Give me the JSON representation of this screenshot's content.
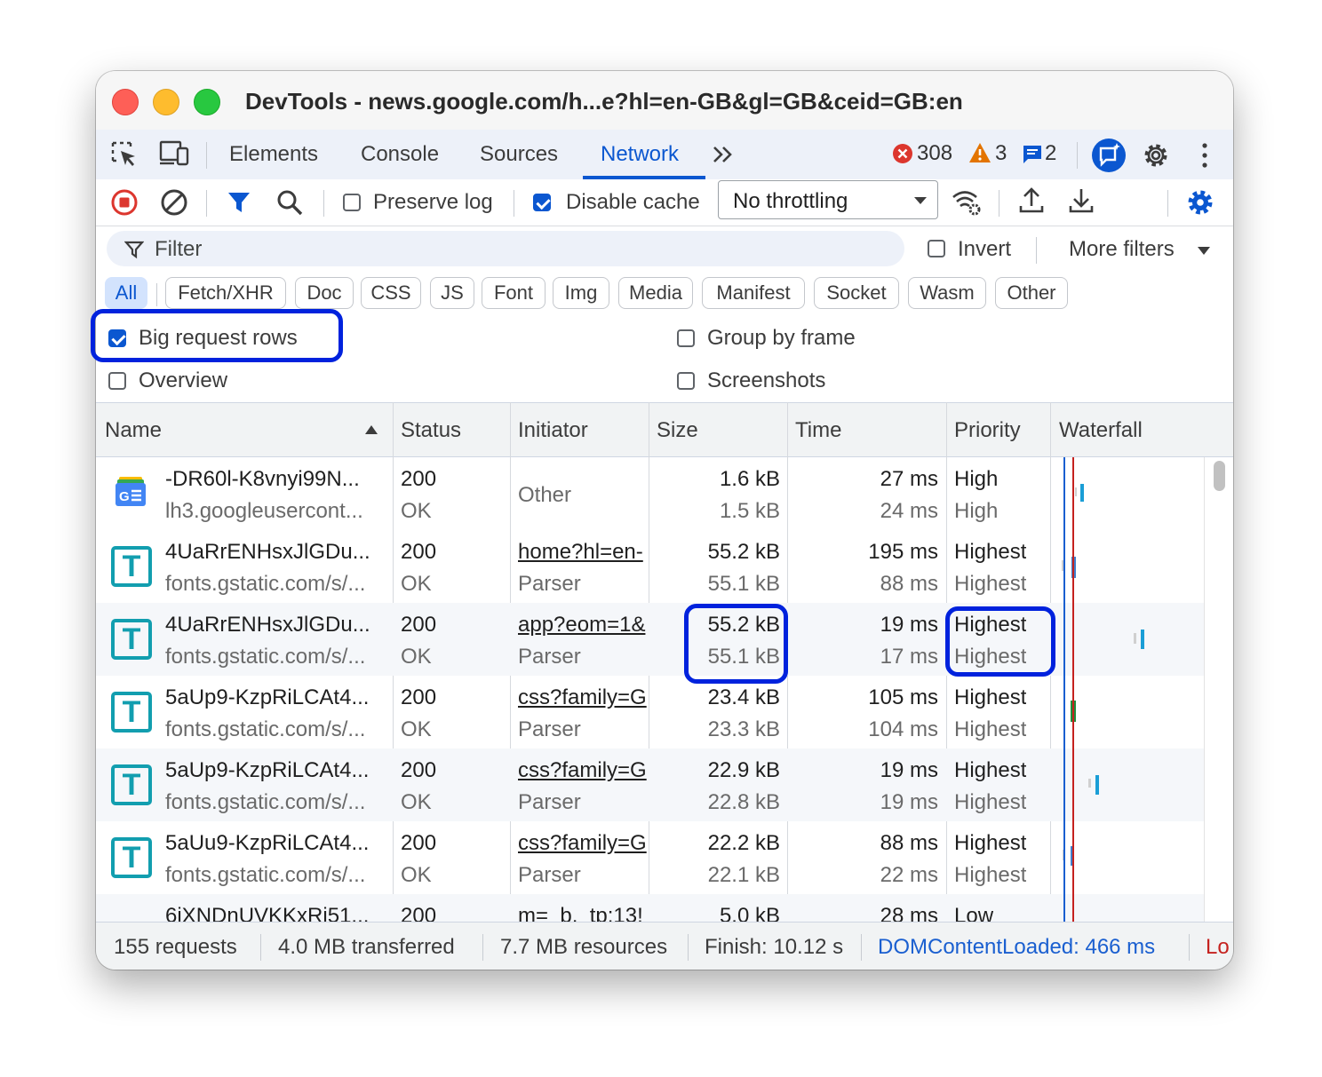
{
  "window": {
    "title": "DevTools - news.google.com/h...e?hl=en-GB&gl=GB&ceid=GB:en"
  },
  "tabs": [
    {
      "label": "Elements",
      "active": false
    },
    {
      "label": "Console",
      "active": false
    },
    {
      "label": "Sources",
      "active": false
    },
    {
      "label": "Network",
      "active": true
    }
  ],
  "badges": {
    "errors": "308",
    "warnings": "3",
    "messages": "2"
  },
  "toolbar": {
    "preserve_log_label": "Preserve log",
    "preserve_log_checked": false,
    "disable_cache_label": "Disable cache",
    "disable_cache_checked": true,
    "throttling_value": "No throttling"
  },
  "filter": {
    "placeholder": "Filter",
    "invert_label": "Invert",
    "more_filters_label": "More filters"
  },
  "chips": [
    "All",
    "Fetch/XHR",
    "Doc",
    "CSS",
    "JS",
    "Font",
    "Img",
    "Media",
    "Manifest",
    "Socket",
    "Wasm",
    "Other"
  ],
  "settings": {
    "big_request_rows": "Big request rows",
    "group_by_frame": "Group by frame",
    "overview": "Overview",
    "screenshots": "Screenshots"
  },
  "columns": {
    "name": "Name",
    "status": "Status",
    "initiator": "Initiator",
    "size": "Size",
    "time": "Time",
    "priority": "Priority",
    "waterfall": "Waterfall"
  },
  "rows": [
    {
      "icon": "google-news-icon",
      "name": "-DR60l-K8vnyi99N...",
      "domain": "lh3.googleusercont...",
      "status": "200",
      "status_text": "OK",
      "initiator": "Other",
      "initiator_type": "",
      "size": "1.6 kB",
      "resource_size": "1.5 kB",
      "time": "27 ms",
      "latency": "24 ms",
      "priority": "High",
      "initial_priority": "High"
    },
    {
      "icon": "font-file-icon",
      "name": "4UaRrENHsxJlGDu...",
      "domain": "fonts.gstatic.com/s/...",
      "status": "200",
      "status_text": "OK",
      "initiator": "home?hl=en-",
      "initiator_type": "Parser",
      "size": "55.2 kB",
      "resource_size": "55.1 kB",
      "time": "195 ms",
      "latency": "88 ms",
      "priority": "Highest",
      "initial_priority": "Highest"
    },
    {
      "icon": "font-file-icon",
      "name": "4UaRrENHsxJlGDu...",
      "domain": "fonts.gstatic.com/s/...",
      "status": "200",
      "status_text": "OK",
      "initiator": "app?eom=1&",
      "initiator_type": "Parser",
      "size": "55.2 kB",
      "resource_size": "55.1 kB",
      "time": "19 ms",
      "latency": "17 ms",
      "priority": "Highest",
      "initial_priority": "Highest"
    },
    {
      "icon": "font-file-icon",
      "name": "5aUp9-KzpRiLCAt4...",
      "domain": "fonts.gstatic.com/s/...",
      "status": "200",
      "status_text": "OK",
      "initiator": "css?family=G",
      "initiator_type": "Parser",
      "size": "23.4 kB",
      "resource_size": "23.3 kB",
      "time": "105 ms",
      "latency": "104 ms",
      "priority": "Highest",
      "initial_priority": "Highest"
    },
    {
      "icon": "font-file-icon",
      "name": "5aUp9-KzpRiLCAt4...",
      "domain": "fonts.gstatic.com/s/...",
      "status": "200",
      "status_text": "OK",
      "initiator": "css?family=G",
      "initiator_type": "Parser",
      "size": "22.9 kB",
      "resource_size": "22.8 kB",
      "time": "19 ms",
      "latency": "19 ms",
      "priority": "Highest",
      "initial_priority": "Highest"
    },
    {
      "icon": "font-file-icon",
      "name": "5aUu9-KzpRiLCAt4...",
      "domain": "fonts.gstatic.com/s/...",
      "status": "200",
      "status_text": "OK",
      "initiator": "css?family=G",
      "initiator_type": "Parser",
      "size": "22.2 kB",
      "resource_size": "22.1 kB",
      "time": "88 ms",
      "latency": "22 ms",
      "priority": "Highest",
      "initial_priority": "Highest"
    },
    {
      "icon": "font-file-icon",
      "name": "6iXNDnUVKKxRi51...",
      "domain": "",
      "status": "200",
      "status_text": "",
      "initiator": "m=_b,_tp:13!",
      "initiator_type": "",
      "size": "5.0 kB",
      "resource_size": "",
      "time": "28 ms",
      "latency": "",
      "priority": "Low",
      "initial_priority": ""
    }
  ],
  "status_bar": {
    "requests": "155 requests",
    "transferred": "4.0 MB transferred",
    "resources": "7.7 MB resources",
    "finish": "Finish: 10.12 s",
    "dom_content_loaded": "DOMContentLoaded: 466 ms",
    "load": "Lo"
  },
  "colors": {
    "accent": "#0b57d0",
    "highlight": "#0022dd",
    "font_icon": "#129eaf",
    "dcl_line": "#1a5fd0",
    "load_line": "#c5221f",
    "load_text": "#c5221f"
  }
}
